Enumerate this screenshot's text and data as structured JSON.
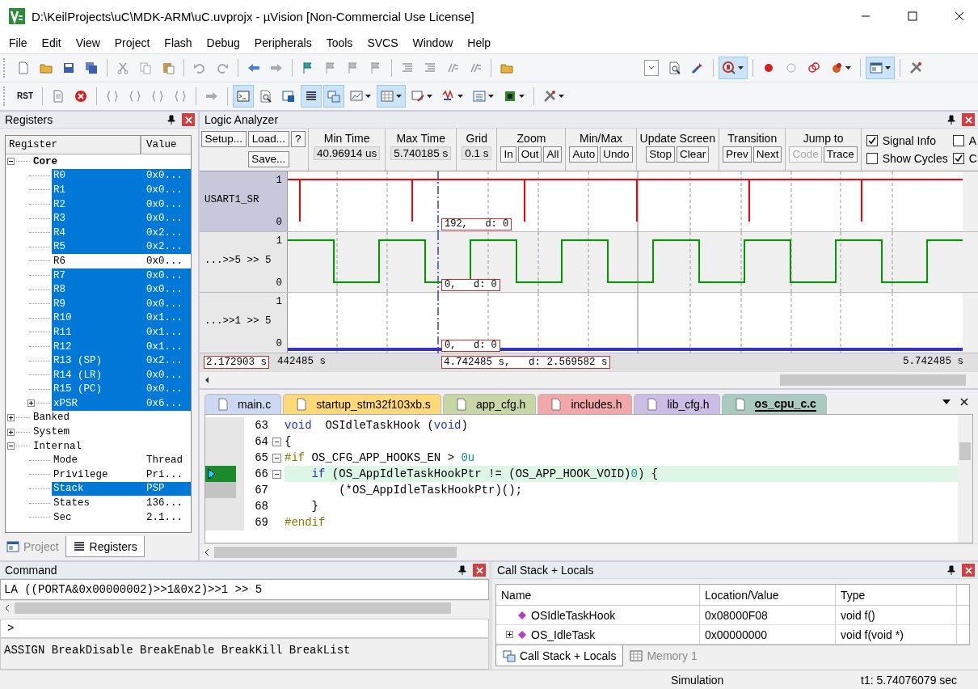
{
  "window": {
    "title": "D:\\KeilProjects\\uC\\MDK-ARM\\uC.uvprojx - µVision  [Non-Commercial Use License]"
  },
  "menu": [
    "File",
    "Edit",
    "View",
    "Project",
    "Flash",
    "Debug",
    "Peripherals",
    "Tools",
    "SVCS",
    "Window",
    "Help"
  ],
  "build_toolbar": [
    {
      "on": false
    },
    {
      "on": false
    },
    {
      "on": false
    },
    {
      "on": false
    },
    {
      "on": false
    },
    {
      "on": false
    },
    {
      "on": false
    },
    {
      "on": false
    },
    {
      "on": false
    },
    {
      "on": false
    },
    {
      "on": false
    },
    {
      "on": false
    },
    {
      "on": false
    },
    {
      "on": false
    },
    {
      "on": false
    },
    {
      "on": false
    },
    {
      "on": false
    },
    {
      "on": false
    },
    {
      "on": false
    },
    {
      "on": false
    },
    {
      "on": false
    },
    {
      "on": false
    },
    {
      "on": false
    },
    {
      "on": true
    },
    {
      "on": false
    },
    {
      "on": false
    },
    {
      "on": false
    },
    {
      "on": false
    },
    {
      "on": true
    },
    {
      "on": false
    }
  ],
  "debug_toolbar": [
    {
      "label": "RST",
      "on": false
    },
    {
      "on": false
    },
    {
      "on": false
    },
    {
      "on": false
    },
    {
      "on": false
    },
    {
      "on": false
    },
    {
      "on": false
    },
    {
      "on": false
    },
    {
      "on": true
    },
    {
      "on": false
    },
    {
      "on": false
    },
    {
      "on": true
    },
    {
      "on": true
    },
    {
      "on": false
    },
    {
      "on": true
    },
    {
      "on": false
    },
    {
      "on": false
    },
    {
      "on": false
    },
    {
      "on": false
    },
    {
      "on": false
    }
  ],
  "registers": {
    "title": "Registers",
    "columns": [
      "Register",
      "Value"
    ],
    "tree": [
      {
        "name": "Core",
        "emphasized": true,
        "expanded": true,
        "children": [
          {
            "name": "R0",
            "value": "0x0...",
            "selected": true
          },
          {
            "name": "R1",
            "value": "0x0...",
            "selected": true
          },
          {
            "name": "R2",
            "value": "0x0...",
            "selected": true
          },
          {
            "name": "R3",
            "value": "0x0...",
            "selected": true
          },
          {
            "name": "R4",
            "value": "0x2...",
            "selected": true
          },
          {
            "name": "R5",
            "value": "0x2...",
            "selected": true
          },
          {
            "name": "R6",
            "value": "0x0...",
            "selected": false
          },
          {
            "name": "R7",
            "value": "0x0...",
            "selected": true
          },
          {
            "name": "R8",
            "value": "0x0...",
            "selected": true
          },
          {
            "name": "R9",
            "value": "0x0...",
            "selected": true
          },
          {
            "name": "R10",
            "value": "0x1...",
            "selected": true
          },
          {
            "name": "R11",
            "value": "0x1...",
            "selected": true
          },
          {
            "name": "R12",
            "value": "0x1...",
            "selected": true
          },
          {
            "name": "R13 (SP)",
            "value": "0x2...",
            "selected": true
          },
          {
            "name": "R14 (LR)",
            "value": "0x0...",
            "selected": true
          },
          {
            "name": "R15 (PC)",
            "value": "0x0...",
            "selected": true
          },
          {
            "name": "xPSR",
            "value": "0x6...",
            "selected": true,
            "expanded": false
          }
        ]
      },
      {
        "name": "Banked",
        "emphasized": false,
        "expanded": false
      },
      {
        "name": "System",
        "emphasized": false,
        "expanded": false
      },
      {
        "name": "Internal",
        "emphasized": false,
        "expanded": true,
        "children": [
          {
            "name": "Mode",
            "value": "Thread",
            "selected": false
          },
          {
            "name": "Privilege",
            "value": "Pri...",
            "selected": false
          },
          {
            "name": "Stack",
            "value": "PSP",
            "selected": true
          },
          {
            "name": "States",
            "value": "136...",
            "selected": false
          },
          {
            "name": "Sec",
            "value": "2.1...",
            "selected": false
          }
        ]
      }
    ],
    "tabs": [
      {
        "label": "Project",
        "selected": false
      },
      {
        "label": "Registers",
        "selected": true
      }
    ]
  },
  "logic_analyzer": {
    "title": "Logic Analyzer",
    "file_buttons": [
      "Setup...",
      "Load...",
      "Save..."
    ],
    "help": "?",
    "readouts": [
      {
        "label": "Min Time",
        "value": "40.96914 us"
      },
      {
        "label": "Max Time",
        "value": "5.740185 s"
      },
      {
        "label": "Grid",
        "value": "0.1 s"
      }
    ],
    "groups": [
      {
        "title": "Zoom",
        "buttons": [
          {
            "label": "In",
            "disabled": false
          },
          {
            "label": "Out",
            "disabled": false
          },
          {
            "label": "All",
            "disabled": false
          }
        ]
      },
      {
        "title": "Min/Max",
        "buttons": [
          {
            "label": "Auto",
            "disabled": false
          },
          {
            "label": "Undo",
            "disabled": false
          }
        ]
      },
      {
        "title": "Update Screen",
        "buttons": [
          {
            "label": "Stop",
            "disabled": false
          },
          {
            "label": "Clear",
            "disabled": false
          }
        ]
      },
      {
        "title": "Transition",
        "buttons": [
          {
            "label": "Prev",
            "disabled": false
          },
          {
            "label": "Next",
            "disabled": false
          }
        ]
      },
      {
        "title": "Jump to",
        "buttons": [
          {
            "label": "Code",
            "disabled": true
          },
          {
            "label": "Trace",
            "disabled": false
          }
        ]
      }
    ],
    "options": [
      {
        "label": "Signal Info",
        "checked": true
      },
      {
        "label": "Show Cycles",
        "checked": false
      },
      {
        "label": "A",
        "checked": false
      },
      {
        "label": "C",
        "checked": true
      }
    ],
    "signals": [
      {
        "name": "USART1_SR",
        "kind": "pulse",
        "color": "#ff0000",
        "selected": true,
        "high": "1",
        "low": "0",
        "cursor_value": "192,   d: 0"
      },
      {
        "name": "...>>5 >> 5",
        "kind": "square",
        "color": "#009900",
        "selected": false,
        "high": "1",
        "low": "0",
        "cursor_value": "0,   d: 0"
      },
      {
        "name": "...>>1 >> 5",
        "kind": "flat",
        "color": "#3333cc",
        "selected": false,
        "high": "1",
        "low": "0",
        "cursor_value": "0,   d: 0"
      }
    ],
    "axis": {
      "left_cursor": "2.172903 s",
      "left_time": "442485 s",
      "cursor": "4.742485 s,   d: 2.569582 s",
      "right_time": "5.742485 s"
    }
  },
  "editor": {
    "tabs": [
      {
        "label": "main.c",
        "color": "#cdd8f2",
        "selected": false
      },
      {
        "label": "startup_stm32f103xb.s",
        "color": "#ffd978",
        "selected": false
      },
      {
        "label": "app_cfg.h",
        "color": "#c6d6a4",
        "selected": false
      },
      {
        "label": "includes.h",
        "color": "#f2a8a8",
        "selected": false
      },
      {
        "label": "lib_cfg.h",
        "color": "#cbbde6",
        "selected": false
      },
      {
        "label": "os_cpu_c.c",
        "color": "#a9cbbf",
        "selected": true
      }
    ],
    "lines": [
      {
        "number": "63",
        "fold": false,
        "current": false,
        "marked": false,
        "tokens": [
          {
            "kind": "keyword",
            "text": "void"
          },
          {
            "kind": "plain",
            "text": "  OSIdleTaskHook ("
          },
          {
            "kind": "keyword",
            "text": "void"
          },
          {
            "kind": "plain",
            "text": ")"
          }
        ]
      },
      {
        "number": "64",
        "fold": true,
        "current": false,
        "marked": false,
        "tokens": [
          {
            "kind": "plain",
            "text": "{"
          }
        ]
      },
      {
        "number": "65",
        "fold": true,
        "current": false,
        "marked": false,
        "tokens": [
          {
            "kind": "directive",
            "text": "#if"
          },
          {
            "kind": "plain",
            "text": " OS_CFG_APP_HOOKS_EN > "
          },
          {
            "kind": "number",
            "text": "0u"
          }
        ]
      },
      {
        "number": "66",
        "fold": true,
        "current": true,
        "marked": false,
        "tokens": [
          {
            "kind": "keyword",
            "text": "    if"
          },
          {
            "kind": "plain",
            "text": " (OS_AppIdleTaskHookPtr != (OS_APP_HOOK_VOID)"
          },
          {
            "kind": "number",
            "text": "0"
          },
          {
            "kind": "plain",
            "text": ") {"
          }
        ]
      },
      {
        "number": "67",
        "fold": false,
        "current": false,
        "marked": true,
        "tokens": [
          {
            "kind": "plain",
            "text": "        (*OS_AppIdleTaskHookPtr)();"
          }
        ]
      },
      {
        "number": "68",
        "fold": false,
        "current": false,
        "marked": false,
        "tokens": [
          {
            "kind": "plain",
            "text": "    }"
          }
        ]
      },
      {
        "number": "69",
        "fold": false,
        "current": false,
        "marked": false,
        "tokens": [
          {
            "kind": "directive",
            "text": "#endif"
          }
        ]
      }
    ]
  },
  "command": {
    "title": "Command",
    "output": "LA ((PORTA&0x00000002)>>1&0x2)>>1 >> 5",
    "prompt": ">",
    "hint": "ASSIGN BreakDisable BreakEnable BreakKill BreakList"
  },
  "call_stack": {
    "title": "Call Stack + Locals",
    "columns": [
      "Name",
      "Location/Value",
      "Type"
    ],
    "rows": [
      {
        "name": "OSIdleTaskHook",
        "location": "0x08000F08",
        "type": "void f()"
      },
      {
        "name": "OS_IdleTask",
        "location": "0x00000000",
        "type": "void f(void *)",
        "expanded": false
      }
    ],
    "tabs": [
      {
        "label": "Call Stack + Locals",
        "selected": true
      },
      {
        "label": "Memory 1",
        "selected": false
      }
    ]
  },
  "status_bar": {
    "mode": "Simulation",
    "time": "t1: 5.74076079 sec"
  }
}
